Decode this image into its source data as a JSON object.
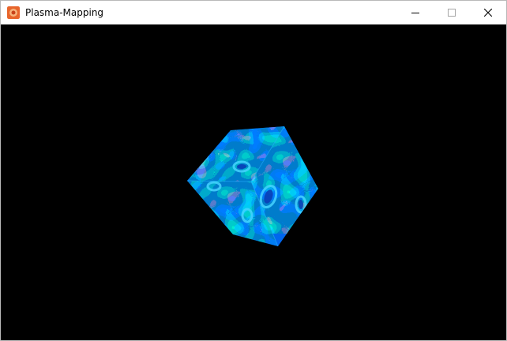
{
  "window": {
    "title": "Plasma-Mapping",
    "icon": "app-icon",
    "controls": [
      "minimize-icon",
      "maximize-icon",
      "close-icon"
    ]
  },
  "scene": {
    "object": "rotating-cube",
    "texture": "plasma",
    "background_color": "#000000",
    "palette": [
      "#003a9e",
      "#0062e8",
      "#0094ff",
      "#3fc8ff",
      "#7df3ff"
    ]
  }
}
